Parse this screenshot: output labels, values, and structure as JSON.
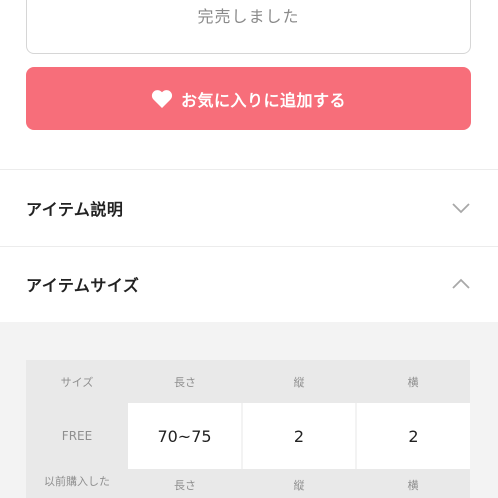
{
  "buttons": {
    "sold_out_label": "完売しました",
    "favorite_label": "お気に入りに追加する"
  },
  "sections": {
    "item_description": "アイテム説明",
    "item_size": "アイテムサイズ"
  },
  "size_table": {
    "headers": [
      "サイズ",
      "長さ",
      "縦",
      "横"
    ],
    "rows": [
      {
        "size": "FREE",
        "values": [
          "70~75",
          "2",
          "2"
        ]
      }
    ],
    "partial_row_label": "以前購入した",
    "partial_row_sub": [
      "長さ",
      "縦",
      "横"
    ]
  },
  "colors": {
    "accent": "#f76e7a",
    "panel_bg": "#f3f3f3",
    "header_cell": "#e9e9e9"
  },
  "icons": {
    "heart": "heart-icon",
    "description_toggle": "chevron-down-icon",
    "size_toggle": "chevron-up-icon"
  }
}
